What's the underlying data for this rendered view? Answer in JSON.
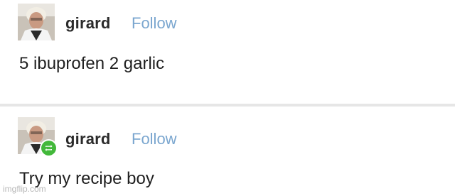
{
  "posts": [
    {
      "username": "girard",
      "follow_label": "Follow",
      "text": "5 ibuprofen 2 garlic",
      "avatar_icon": "user-avatar-photo",
      "reblog": false
    },
    {
      "username": "girard",
      "follow_label": "Follow",
      "text": "Try my recipe boy",
      "avatar_icon": "user-avatar-photo",
      "reblog": true,
      "reblog_icon": "reblog-icon",
      "reblog_color": "#42b83a"
    }
  ],
  "colors": {
    "follow": "#7aa6cf",
    "username": "#2b2b2b",
    "divider": "#e6e6e6"
  },
  "watermark": "imgflip.com"
}
